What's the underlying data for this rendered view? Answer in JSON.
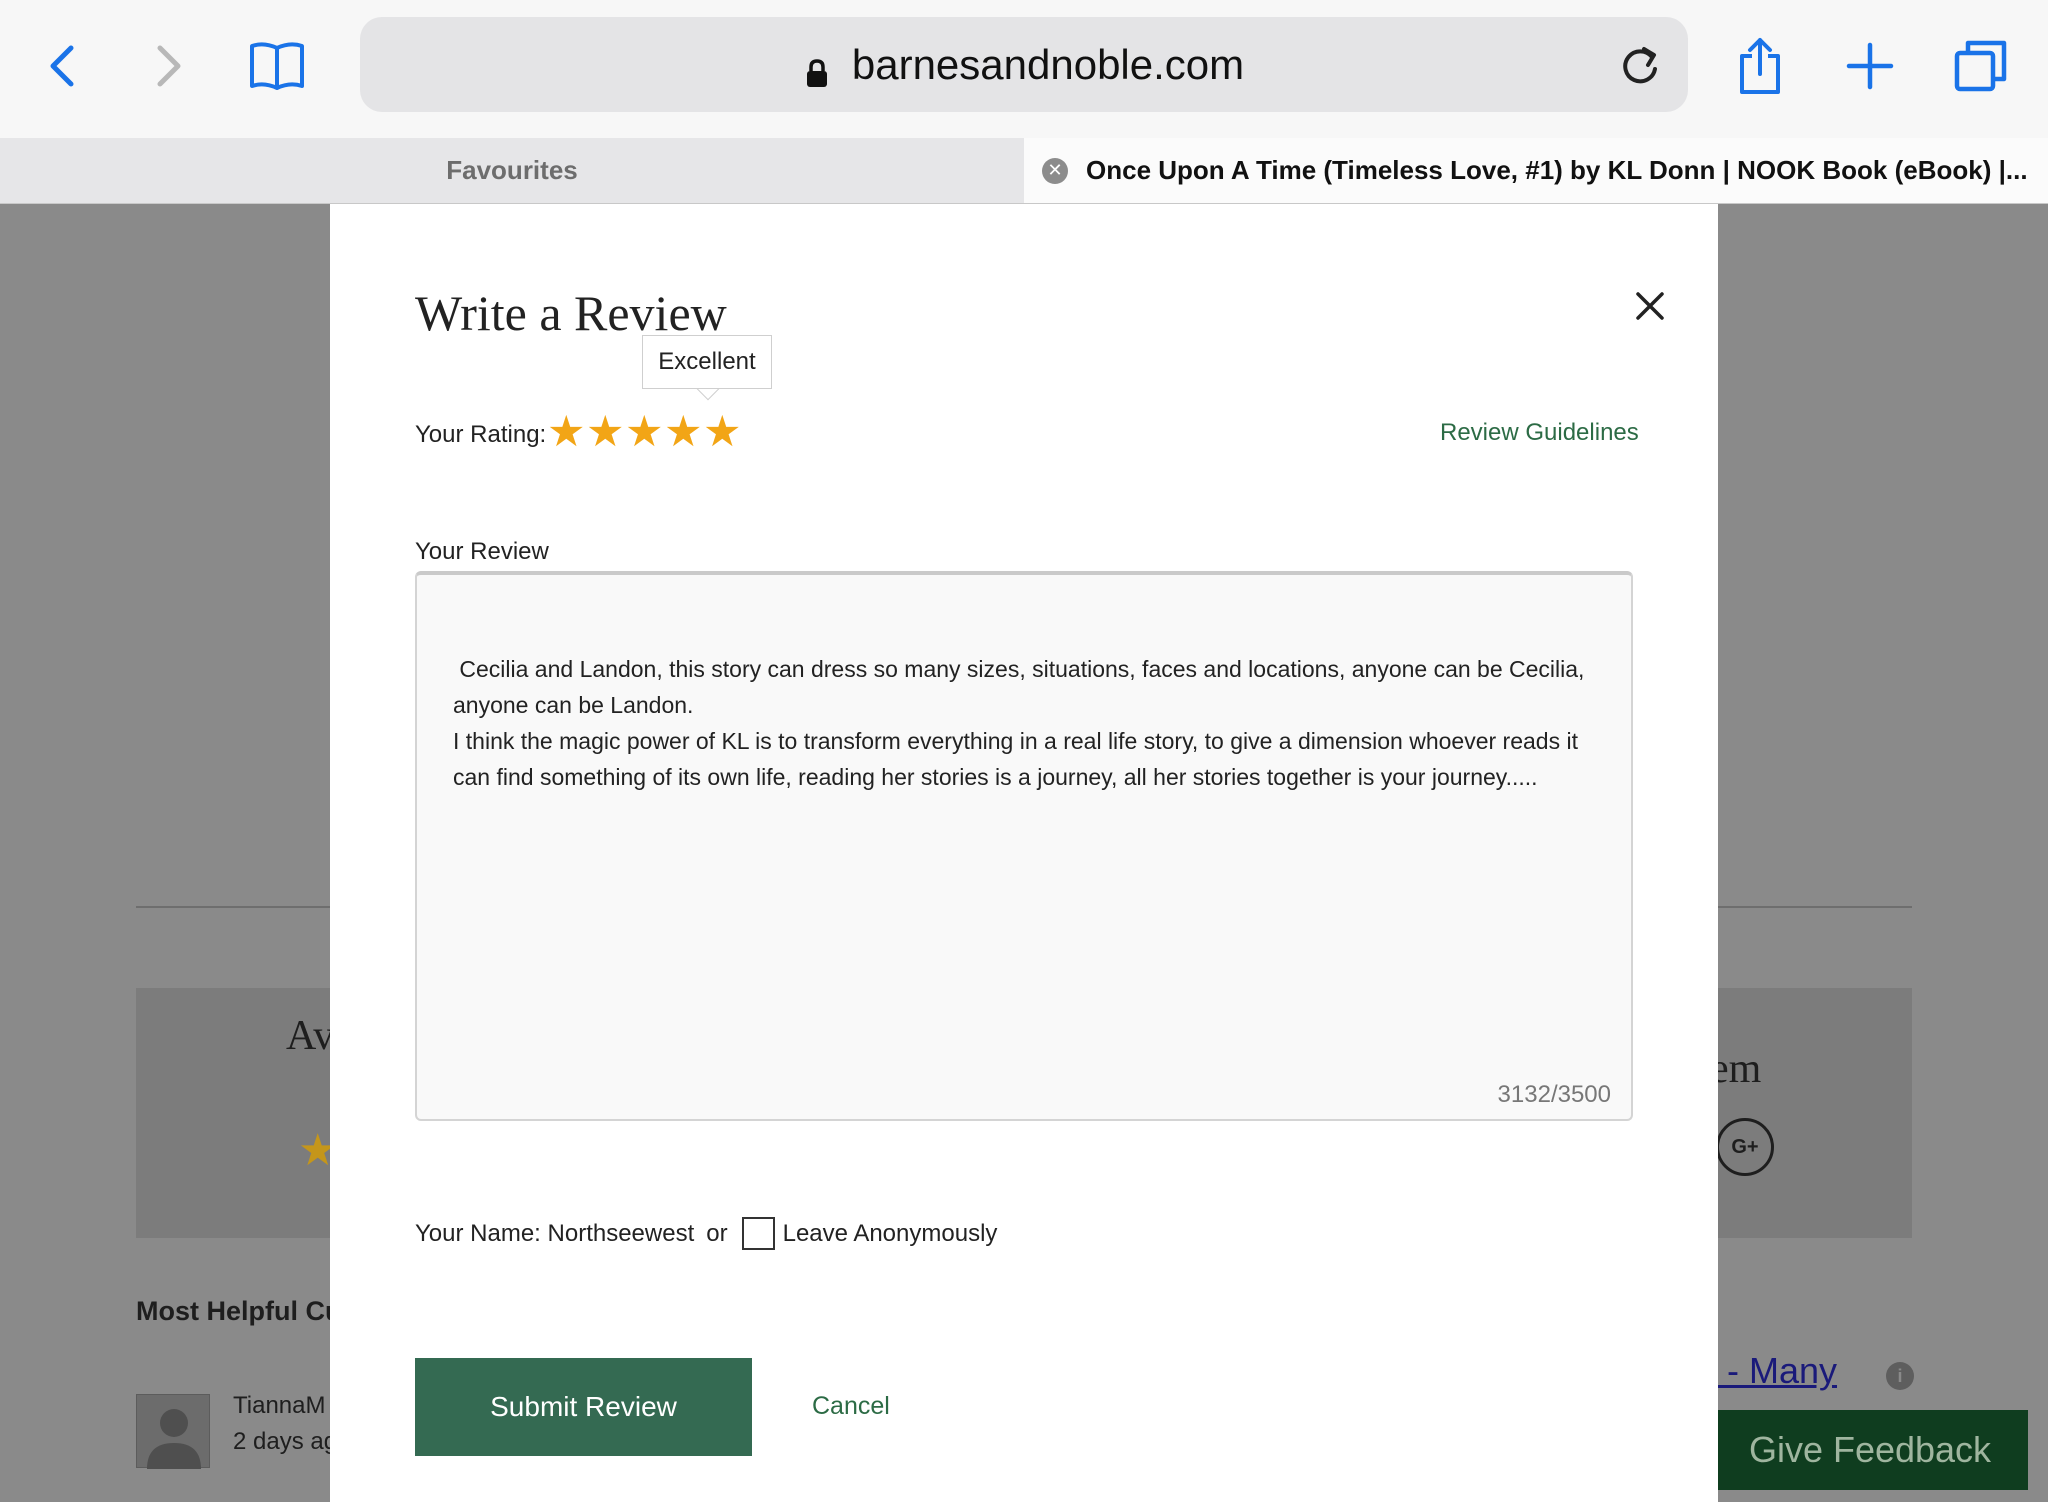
{
  "browser": {
    "url": "barnesandnoble.com",
    "tabs": [
      {
        "label": "Favourites"
      },
      {
        "label": "Once Upon A Time (Timeless Love, #1) by KL Donn | NOOK Book (eBook) |..."
      }
    ],
    "accent_color": "#1a73e8"
  },
  "background_page": {
    "heading_fragment_left": "Av",
    "heading_fragment_right": "em",
    "social_icon": "G+",
    "most_helpful_fragment": "Most Helpful Cu",
    "reviewer_name_fragment": "TiannaM",
    "reviewer_time_fragment": "2 days ag",
    "sort_link_fragment": ") - Many",
    "info_icon": "i",
    "feedback_button": "Give Feedback"
  },
  "modal": {
    "title": "Write a Review",
    "rating_label": "Your Rating:",
    "rating_value": 5,
    "rating_max": 5,
    "rating_tooltip": "Excellent",
    "guidelines_link": "Review Guidelines",
    "review_label": "Your Review",
    "review_text": " Cecilia and Landon, this story can dress so many sizes, situations, faces and locations, anyone can be Cecilia, anyone can be Landon.\nI think the magic power of KL is to transform everything in a real life story, to give a dimension whoever reads it can find something of its own life, reading her stories is a journey, all her stories together is your journey.....",
    "char_counter": "3132/3500",
    "name_prefix": "Your Name: Northseewest",
    "or_text": "or",
    "anonymous_label": "Leave Anonymously",
    "submit_label": "Submit Review",
    "cancel_label": "Cancel",
    "star_color": "#f2a516",
    "button_color": "#346a52"
  }
}
